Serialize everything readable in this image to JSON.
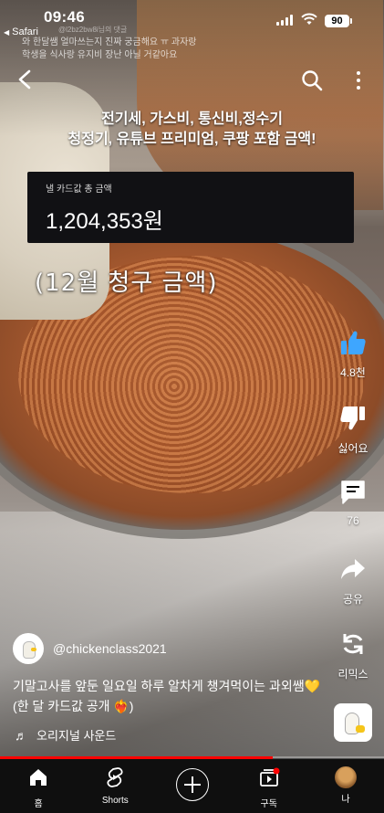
{
  "status_bar": {
    "time": "09:46",
    "battery": "90",
    "back_app": "Safari"
  },
  "ghost_comment": {
    "user": "@l2bz2bw8i님의 댓글",
    "text": "와 한달쌤 얼마쓰는지 진짜 궁금해요 ㅠ 과자랑 학생을 식사랑 유지비 장난 아닐 거같아요"
  },
  "captions": {
    "line1": "전기세, 가스비, 통신비,정수기",
    "line2": "청정기, 유튜브 프리미엄, 쿠팡 포함 금액!",
    "card_label": "낼 카드값 총 금액",
    "card_amount": "1,204,353원",
    "handwritten": "(12월 청구 금액)"
  },
  "rail": {
    "like_count": "4.8천",
    "dislike_label": "싫어요",
    "comment_count": "76",
    "share_label": "공유",
    "remix_label": "리믹스"
  },
  "video": {
    "channel": "@chickenclass2021",
    "title": "기말고사를 앞둔 일요일 하루 알차게 챙겨먹이는 과외쌤💛 (한 달 카드값 공개 ❤️‍🔥)",
    "sound": "오리지널 사운드",
    "progress": 0.71
  },
  "nav": {
    "home": "홈",
    "shorts": "Shorts",
    "subscriptions": "구독",
    "me": "나"
  },
  "colors": {
    "accent": "#ff0000",
    "like": "#3ea6ff",
    "nav_bg": "#0f0f0f"
  }
}
